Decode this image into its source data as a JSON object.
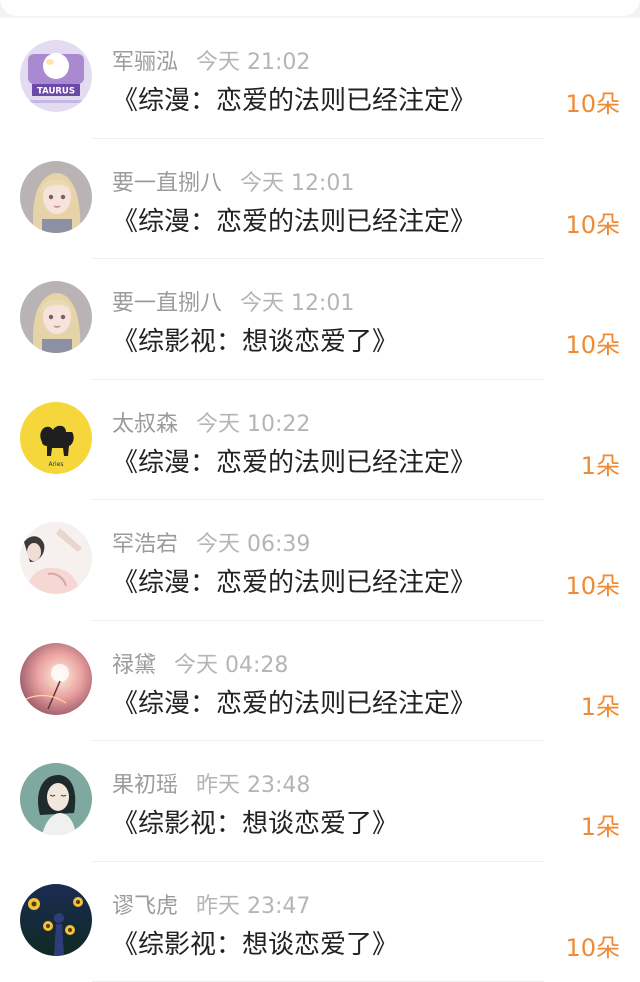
{
  "colors": {
    "count_accent": "#f08a34",
    "name_text": "#9b9b9b",
    "title_text": "#222222"
  },
  "gifts": [
    {
      "name": "军骊泓",
      "time": "今天 21:02",
      "book": "《综漫：恋爱的法则已经注定》",
      "count": "10朵",
      "avatar_icon": "taurus-avatar-icon",
      "avatar_text": "TAURUS"
    },
    {
      "name": "要一直捌八",
      "time": "今天 12:01",
      "book": "《综漫：恋爱的法则已经注定》",
      "count": "10朵",
      "avatar_icon": "anime-girl-avatar-icon"
    },
    {
      "name": "要一直捌八",
      "time": "今天 12:01",
      "book": "《综影视：想谈恋爱了》",
      "count": "10朵",
      "avatar_icon": "anime-girl-avatar-icon"
    },
    {
      "name": "太叔森",
      "time": "今天 10:22",
      "book": "《综漫：恋爱的法则已经注定》",
      "count": "1朵",
      "avatar_icon": "aries-avatar-icon",
      "avatar_text": "Aries"
    },
    {
      "name": "罕浩宕",
      "time": "今天 06:39",
      "book": "《综漫：恋爱的法则已经注定》",
      "count": "10朵",
      "avatar_icon": "sketch-girl-avatar-icon"
    },
    {
      "name": "禄黛",
      "time": "今天 04:28",
      "book": "《综漫：恋爱的法则已经注定》",
      "count": "1朵",
      "avatar_icon": "dandelion-avatar-icon"
    },
    {
      "name": "果初瑶",
      "time": "昨天 23:48",
      "book": "《综影视：想谈恋爱了》",
      "count": "1朵",
      "avatar_icon": "teal-girl-avatar-icon"
    },
    {
      "name": "谬飞虎",
      "time": "昨天 23:47",
      "book": "《综影视：想谈恋爱了》",
      "count": "10朵",
      "avatar_icon": "sunflower-night-avatar-icon"
    }
  ]
}
